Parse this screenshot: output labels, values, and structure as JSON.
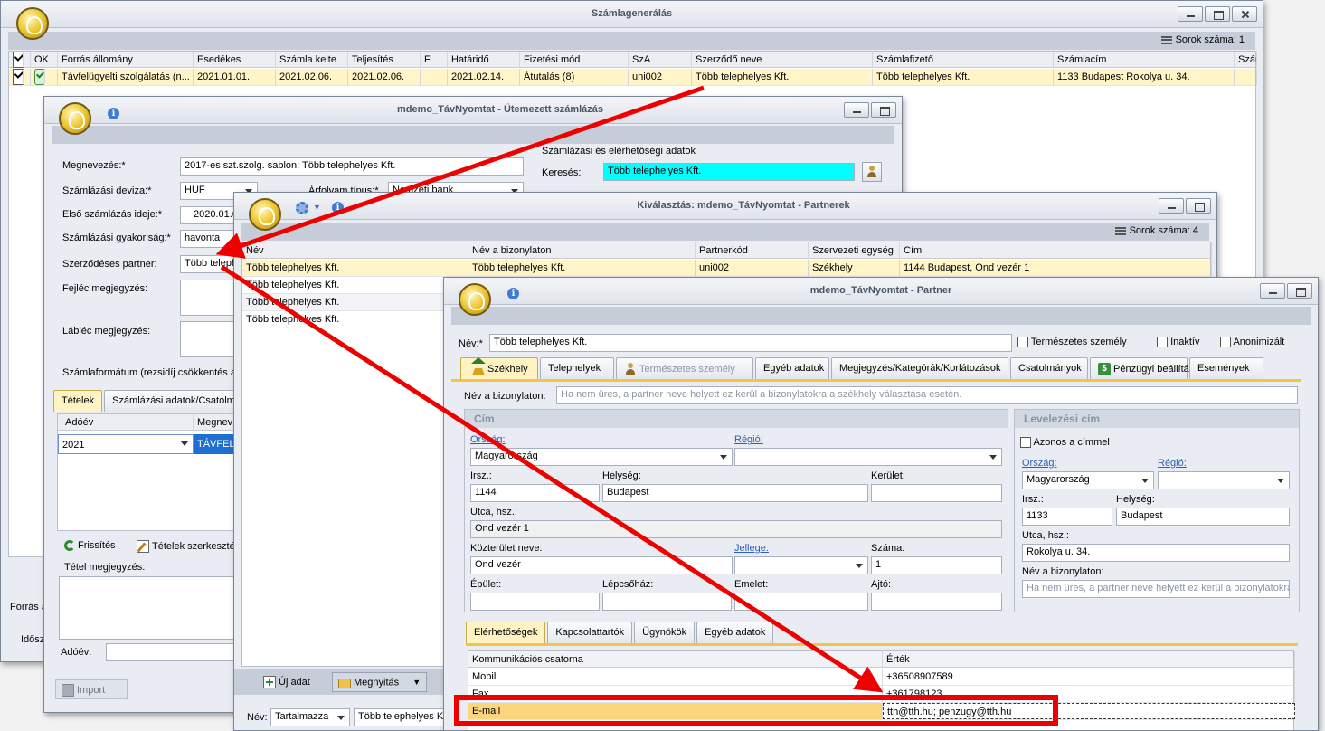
{
  "szamlagen": {
    "title": "Számlagenerálás",
    "row_count": "Sorok száma: 1",
    "columns": [
      "OK",
      "Forrás állomány",
      "Esedékes",
      "Számla kelte",
      "Teljesítés",
      "F",
      "Határidő",
      "Fizetési mód",
      "SzA",
      "Szerződő neve",
      "Számlafizető",
      "Számlacím",
      "Szám"
    ],
    "row": {
      "forras": "Távfelügyelti szolgálatás (n...",
      "esedekes": "2021.01.01.",
      "kelte": "2021.02.06.",
      "teljesites": "2021.02.06.",
      "hatarido": "2021.02.14.",
      "fizmod": "Átutalás (8)",
      "sza": "uni002",
      "szerzodo": "Több telephelyes Kft.",
      "fizeto": "Több telephelyes Kft.",
      "cim": "1133 Budapest Rokolya u. 34."
    },
    "bottom_labels": {
      "forras": "Forrás á",
      "idosz": "Idősz"
    }
  },
  "utemezett": {
    "title": "mdemo_TávNyomtat - Ütemezett számlázás",
    "labels": {
      "megnevezes": "Megnevezés:*",
      "deviza": "Számlázási deviza:*",
      "elso": "Első számlázás ideje:*",
      "gyakorisag": "Számlázási gyakoriság:*",
      "partner": "Szerződéses partner:",
      "fejlec": "Fejléc megjegyzés:",
      "lablec": "Lábléc megjegyzés:",
      "formatum": "Számlaformátum (rezsidíj csökkentés alk",
      "arfolyam": "Árfolyam típus:*",
      "szamlazasi_adatok": "Számlázási és elérhetőségi adatok",
      "kereses": "Keresés:",
      "tetel_megj": "Tétel megjegyzés:",
      "adoev": "Adóév:"
    },
    "values": {
      "megnevezes": "2017-es szt.szolg. sablon: Több telephelyes Kft.",
      "deviza": "HUF",
      "arfolyam": "Nemzeti bank",
      "elso": "2020.01.0",
      "gyakorisag": "havonta",
      "partner": "Több teleph",
      "kereses": "Több telephelyes Kft."
    },
    "tabs": [
      "Tételek",
      "Számlázási adatok/Csatolmány"
    ],
    "grid_cols": [
      "Adóév",
      "Megnev"
    ],
    "grid_row": {
      "adoev": "2021",
      "megnev": "TÁVFELÜ"
    },
    "buttons": {
      "frissites": "Frissítés",
      "tetelek_szerk": "Tételek szerkesztés",
      "import": "Import"
    }
  },
  "kivalasztas": {
    "title": "Kiválasztás: mdemo_TávNyomtat - Partnerek",
    "row_count": "Sorok száma: 4",
    "columns": [
      "Név",
      "Név a bizonylaton",
      "Partnerkód",
      "Szervezeti egység",
      "Cím"
    ],
    "rows": [
      {
        "nev": "Több telephelyes Kft.",
        "biz": "Több telephelyes Kft.",
        "kod": "uni002",
        "egys": "Székhely",
        "cim": "1144 Budapest, Ond vezér 1"
      },
      {
        "nev": "Több telephelyes Kft."
      },
      {
        "nev": "Több telephelyes Kft."
      },
      {
        "nev": "Több telephelyes Kft."
      }
    ],
    "buttons": {
      "uj": "Új adat",
      "megnyitas": "Megnyitás"
    },
    "filter": {
      "label": "Név:",
      "mode": "Tartalmazza",
      "value": "Több telephelyes Kft"
    }
  },
  "partner": {
    "title": "mdemo_TávNyomtat - Partner",
    "nev_label": "Név:*",
    "nev_value": "Több telephelyes Kft.",
    "checks": {
      "termeszetes": "Természetes személy",
      "inaktiv": "Inaktív",
      "anonim": "Anonimizált"
    },
    "tabs": [
      "Székhely",
      "Telephelyek",
      "Természetes személy",
      "Egyéb adatok",
      "Megjegyzés/Kategórák/Korlátozások",
      "Csatolmányok",
      "Pénzügyi beállítások",
      "Események"
    ],
    "biz_label": "Név a bizonylaton:",
    "biz_placeholder": "Ha nem üres, a partner neve helyett ez kerül a bizonylatokra a székhely választása esetén.",
    "cim": {
      "title": "Cím",
      "orszag_label": "Ország:",
      "orszag": "Magyarország",
      "regio_label": "Régió:",
      "irsz_label": "Irsz.:",
      "irsz": "1144",
      "helyseg_label": "Helység:",
      "helyseg": "Budapest",
      "kerulet_label": "Kerület:",
      "utca_label": "Utca, hsz.:",
      "utca": "Ond vezér 1",
      "kozterulet_label": "Közterület neve:",
      "kozterulet": "Ond vezér",
      "jellege_label": "Jellege:",
      "szama_label": "Száma:",
      "szama": "1",
      "epulet_label": "Épület:",
      "lepcsohaz_label": "Lépcsőház:",
      "emelet_label": "Emelet:",
      "ajto_label": "Ajtó:"
    },
    "lev": {
      "title": "Levelezési cím",
      "azonos": "Azonos a címmel",
      "orszag_label": "Ország:",
      "orszag": "Magyarország",
      "regio_label": "Régió:",
      "irsz_label": "Irsz.:",
      "irsz": "1133",
      "helyseg_label": "Helység:",
      "helyseg": "Budapest",
      "utca_label": "Utca, hsz.:",
      "utca": "Rokolya u. 34.",
      "biz_label": "Név a bizonylaton:",
      "biz_placeholder": "Ha nem üres, a partner neve helyett ez kerül a bizonylatokra"
    },
    "subtabs": [
      "Elérhetőségek",
      "Kapcsolattartók",
      "Ügynökök",
      "Egyéb adatok"
    ],
    "contact_cols": [
      "Kommunikációs csatorna",
      "Érték"
    ],
    "contacts": [
      {
        "channel": "Mobil",
        "value": "+36508907589"
      },
      {
        "channel": "Fax",
        "value": "+361798123"
      },
      {
        "channel": "E-mail",
        "value": "tth@tth.hu; penzugy@tth.hu"
      }
    ]
  },
  "colors": {
    "arrow": "#ee0000",
    "highlight": "#ee0000",
    "search_bg": "#00ffff",
    "selected_row": "#fff5c9"
  }
}
